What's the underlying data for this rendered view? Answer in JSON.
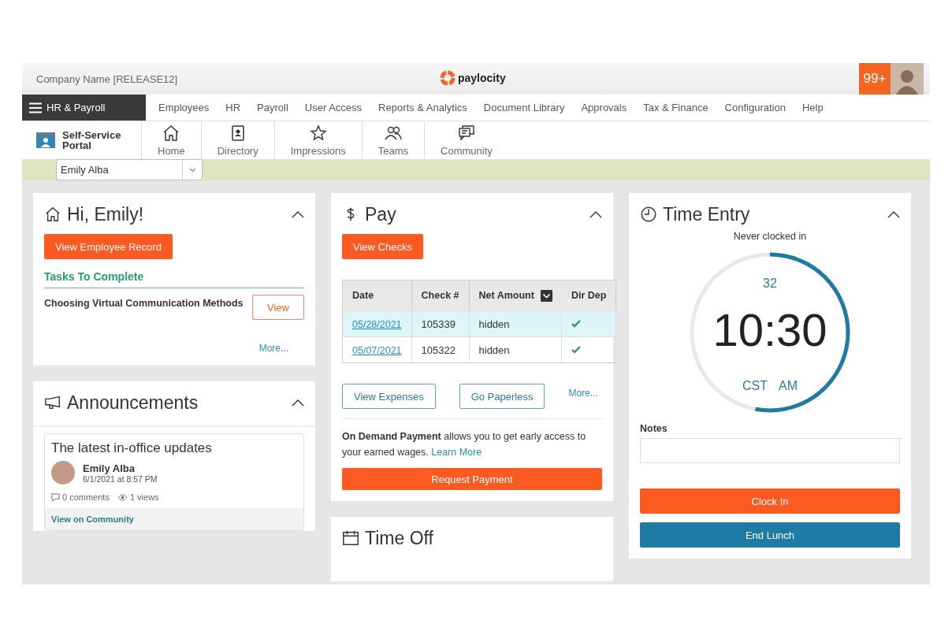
{
  "header": {
    "company": "Company Name [RELEASE12]",
    "logo": "paylocity",
    "notification_count": "99+"
  },
  "main_menu": {
    "label": "HR & Payroll",
    "items": [
      "Employees",
      "HR",
      "Payroll",
      "User Access",
      "Reports & Analytics",
      "Document Library",
      "Approvals",
      "Tax & Finance",
      "Configuration",
      "Help"
    ]
  },
  "portal": {
    "title": "Self-Service Portal",
    "tabs": [
      "Home",
      "Directory",
      "Impressions",
      "Teams",
      "Community"
    ]
  },
  "employee_select": {
    "value": "Emily Alba"
  },
  "welcome": {
    "title": "Hi, Emily!",
    "button": "View Employee Record",
    "tasks_heading": "Tasks To Complete",
    "tasks": [
      {
        "name": "Choosing Virtual Communication Methods",
        "action": "View"
      }
    ],
    "more": "More..."
  },
  "announcements": {
    "title": "Announcements",
    "posts": [
      {
        "title": "The latest in-office updates",
        "author": "Emily Alba",
        "date": "6/1/2021 at 8:57 PM",
        "comments": "0 comments",
        "views": "1 views",
        "link": "View on Community"
      }
    ]
  },
  "pay": {
    "title": "Pay",
    "button": "View Checks",
    "table": {
      "columns": [
        "Date",
        "Check #",
        "Net Amount",
        "Dir Dep"
      ],
      "rows": [
        {
          "date": "05/28/2021",
          "check": "105339",
          "net_amount": "hidden",
          "direct_deposit": true,
          "selected": true
        },
        {
          "date": "05/07/2021",
          "check": "105322",
          "net_amount": "hidden",
          "direct_deposit": true,
          "selected": false
        }
      ]
    },
    "buttons": [
      "View Expenses",
      "Go Paperless"
    ],
    "more": "More...",
    "promo": "**On Demand Payment** allows you to get early access to your earned wages.",
    "promo_link": "Learn More",
    "request_button": "Request Payment"
  },
  "time_off": {
    "title": "Time Off"
  },
  "time_entry": {
    "title": "Time Entry",
    "status": "Never clocked in",
    "clock": {
      "seconds": "32",
      "level": 0.53,
      "time": "10:30",
      "zone": "CST",
      "period": "AM"
    },
    "notes_label": "Notes",
    "buttons": [
      {
        "label": "Clock In",
        "kind": "primary"
      },
      {
        "label": "End Lunch",
        "kind": "secondary"
      }
    ]
  }
}
